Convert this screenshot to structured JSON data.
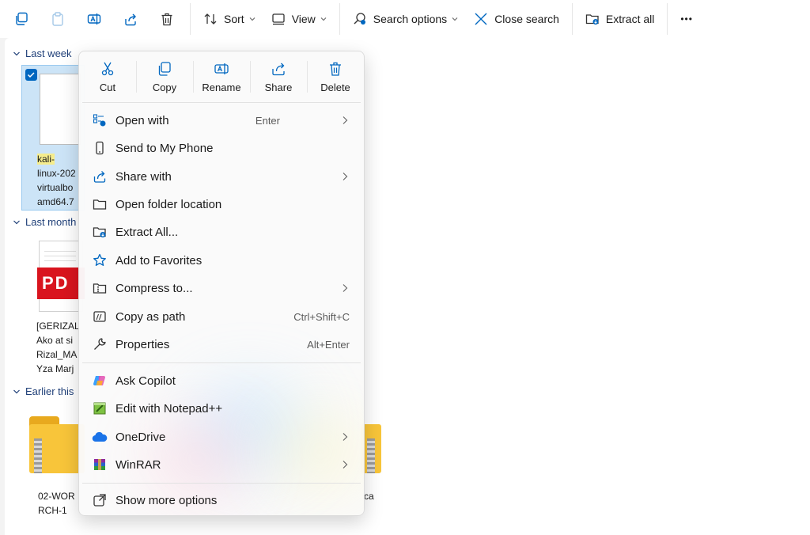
{
  "toolbar": {
    "sort_label": "Sort",
    "view_label": "View",
    "search_options_label": "Search options",
    "close_search_label": "Close search",
    "extract_all_label": "Extract all",
    "more_label": "•••"
  },
  "groups": {
    "last_week": "Last week",
    "last_month": "Last month",
    "earlier": "Earlier this"
  },
  "files": {
    "kali_line1": "kali-",
    "kali_rest": "linux-202\nvirtualbo\namd64.7",
    "pdf_badge": "PD",
    "pdf_name": "[GERIZAL\nAko at si\nRizal_MA\nYza Marj",
    "zip1_name": "02-WOR\nRCH-1",
    "zip2_name": "ca"
  },
  "context_menu": {
    "actions": [
      {
        "label": "Cut",
        "icon": "scissors-icon"
      },
      {
        "label": "Copy",
        "icon": "copy-icon"
      },
      {
        "label": "Rename",
        "icon": "rename-icon"
      },
      {
        "label": "Share",
        "icon": "share-icon"
      },
      {
        "label": "Delete",
        "icon": "trash-icon"
      }
    ],
    "items": [
      {
        "label": "Open with",
        "shortcut": "Enter"
      },
      {
        "label": "Send to My Phone",
        "shortcut": ""
      },
      {
        "label": "Share with",
        "shortcut": ""
      },
      {
        "label": "Open folder location",
        "shortcut": ""
      },
      {
        "label": "Extract All...",
        "shortcut": ""
      },
      {
        "label": "Add to Favorites",
        "shortcut": ""
      },
      {
        "label": "Compress to...",
        "shortcut": ""
      },
      {
        "label": "Copy as path",
        "shortcut": "Ctrl+Shift+C"
      },
      {
        "label": "Properties",
        "shortcut": "Alt+Enter"
      },
      {
        "label": "Ask Copilot",
        "shortcut": ""
      },
      {
        "label": "Edit with Notepad++",
        "shortcut": ""
      },
      {
        "label": "OneDrive",
        "shortcut": ""
      },
      {
        "label": "WinRAR",
        "shortcut": ""
      },
      {
        "label": "Show more options",
        "shortcut": ""
      }
    ]
  },
  "colors": {
    "accent": "#0067c0",
    "group_header": "#1f3f78",
    "highlight": "#f5ec8c",
    "pdf_red": "#d9141e",
    "folder_yellow": "#f8c53a"
  }
}
